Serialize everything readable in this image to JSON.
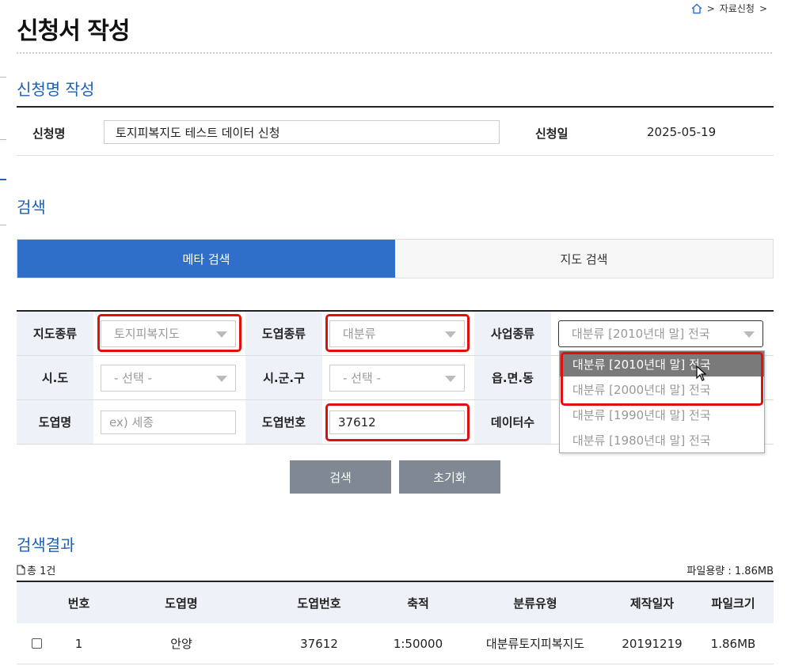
{
  "breadcrumb": {
    "items": [
      "자료신청"
    ],
    "separator": ">"
  },
  "page": {
    "title": "신청서 작성"
  },
  "application": {
    "section_title": "신청명 작성",
    "name_label": "신청명",
    "name_value": "토지피복지도 테스트 데이터 신청",
    "date_label": "신청일",
    "date_value": "2025-05-19"
  },
  "search": {
    "section_title": "검색",
    "tabs": [
      {
        "label": "메타 검색",
        "active": true
      },
      {
        "label": "지도 검색",
        "active": false
      }
    ],
    "fields": {
      "map_type": {
        "label": "지도종류",
        "value": "토지피복지도"
      },
      "sheet_type": {
        "label": "도엽종류",
        "value": "대분류"
      },
      "project_type": {
        "label": "사업종류",
        "value": "대분류 [2010년대 말] 전국"
      },
      "sido": {
        "label": "시.도",
        "value": "- 선택 -"
      },
      "sigungu": {
        "label": "시.군.구",
        "value": "- 선택 -"
      },
      "eupmyeondong": {
        "label": "읍.면.동"
      },
      "sheet_name": {
        "label": "도엽명",
        "placeholder": "ex) 세종"
      },
      "sheet_number": {
        "label": "도엽번호",
        "value": "37612"
      },
      "data_count": {
        "label": "데이터수"
      }
    },
    "dropdown_options": [
      "대분류 [2010년대 말] 전국",
      "대분류 [2000년대 말] 전국",
      "대분류 [1990년대 말] 전국",
      "대분류 [1980년대 말] 전국"
    ],
    "search_button": "검색",
    "reset_button": "초기화"
  },
  "results": {
    "section_title": "검색결과",
    "total": "총 1건",
    "file_size_total": "파일용량 : 1.86MB",
    "headers": [
      "번호",
      "도엽명",
      "도엽번호",
      "축적",
      "분류유형",
      "제작일자",
      "파일크기"
    ],
    "rows": [
      [
        "1",
        "안양",
        "37612",
        "1:50000",
        "대분류토지피복지도",
        "20191219",
        "1.86MB"
      ]
    ]
  },
  "colors": {
    "accent": "#2f6fc9",
    "section_title": "#1f5fb0",
    "highlight": "#e01010",
    "button": "#7f8893"
  }
}
